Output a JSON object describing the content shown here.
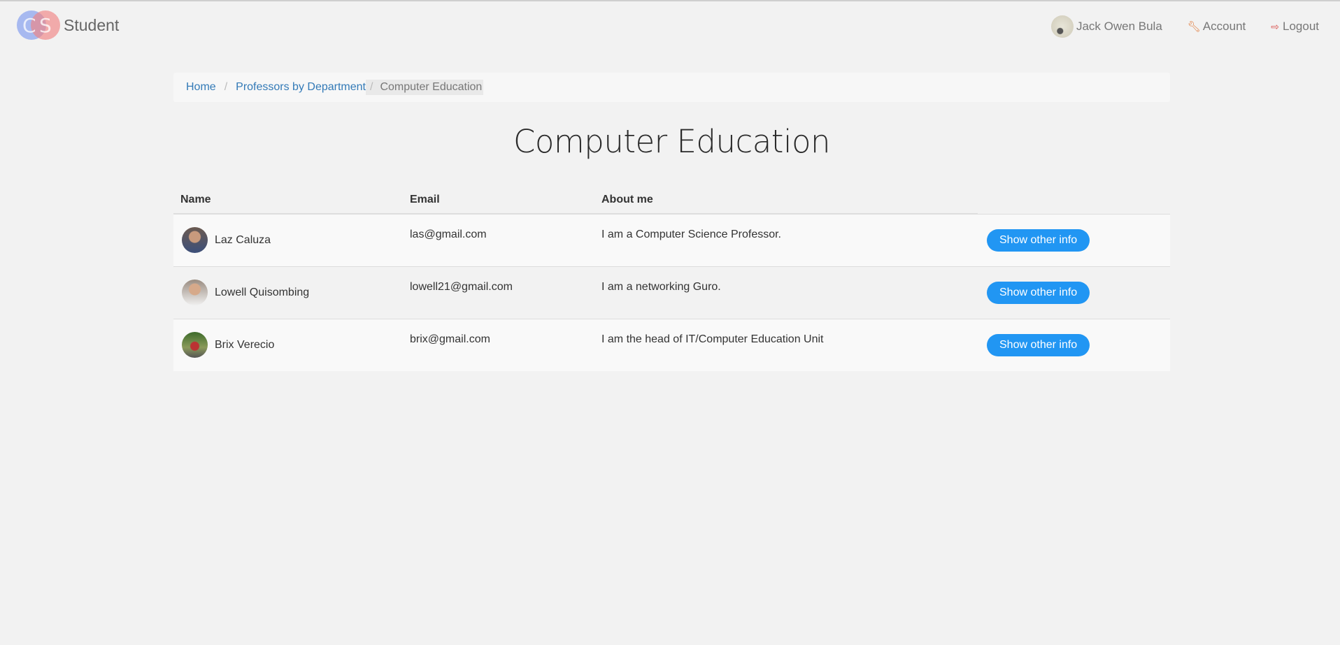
{
  "nav": {
    "brand_letters": [
      "C",
      "S"
    ],
    "brand_name": "Student",
    "user_name": "Jack Owen Bula",
    "account_label": "Account",
    "logout_label": "Logout"
  },
  "breadcrumb": {
    "home": "Home",
    "parent": "Professors by Department",
    "current": "Computer Education",
    "separator": "/"
  },
  "page_title": "Computer Education",
  "table": {
    "headers": [
      "Name",
      "Email",
      "About me",
      ""
    ],
    "rows": [
      {
        "name": "Laz Caluza",
        "email": "las@gmail.com",
        "about": "I am a Computer Science Professor.",
        "action": "Show other info"
      },
      {
        "name": "Lowell Quisombing",
        "email": "lowell21@gmail.com",
        "about": "I am a networking Guro.",
        "action": "Show other info"
      },
      {
        "name": "Brix Verecio",
        "email": "brix@gmail.com",
        "about": "I am the head of IT/Computer Education Unit",
        "action": "Show other info"
      }
    ]
  },
  "colors": {
    "accent": "#2196f3",
    "link": "#337ab7",
    "background": "#f2f2f2"
  },
  "icons": {
    "account": "wrench-icon",
    "logout": "sign-out-icon"
  }
}
